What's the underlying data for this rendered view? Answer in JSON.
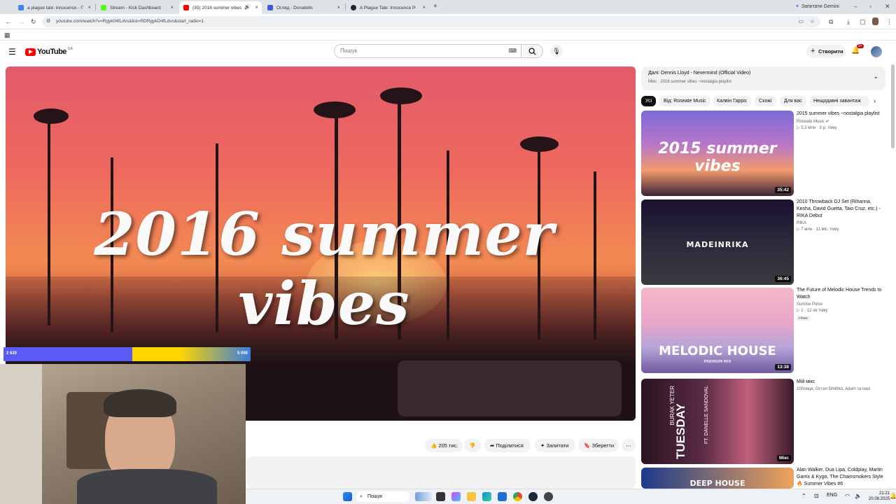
{
  "browser": {
    "tabs": [
      {
        "label": "a plague tale: innocence - Пош",
        "favicon_color": "#4285f4"
      },
      {
        "label": "Stream - Kick Dashboard",
        "favicon_color": "#53fc18"
      },
      {
        "label": "(35) 2016 summer vibes ~n",
        "favicon_color": "#ff0000"
      },
      {
        "label": "Огляд - Donatello",
        "favicon_color": "#3b5bdb"
      },
      {
        "label": "A Plague Tale: Innocence Price",
        "favicon_color": "#1b2838"
      }
    ],
    "gemini_button": "Запитати Gemini",
    "url": "youtube.com/watch?v=Rgyk04fLdvs&list=RDRgykO4fLdvs&start_radio=1"
  },
  "youtube": {
    "logo_text": "YouTube",
    "region": "UA",
    "search_placeholder": "Пошук",
    "create_label": "Створити",
    "notif_count": "9+"
  },
  "video": {
    "title_overlay": "2016 summer vibes"
  },
  "stream_overlay": {
    "goal_left": "2 620",
    "goal_right": "5 000",
    "goal_fraction": 0.52
  },
  "actions": {
    "likes": "205 тис.",
    "share": "Поділитися",
    "ask": "Запитати",
    "save": "Зберегти"
  },
  "sidebar": {
    "next_label": "Далі: Dennis Lloyd - Nevermind (Official Video)",
    "next_sub": "Мікс · 2016 summer vibes ~nostalgia playlist",
    "chips": [
      "Усі",
      "Від: Roseate Music",
      "Калвін Гарріс",
      "Схожі",
      "Для вас",
      "Нещодавні завантаж"
    ],
    "videos": [
      {
        "title": "2015 summer vibes ~nostalgia playlist",
        "channel": "Roseate Music",
        "meta": "▷ 5,3 млн · 3 р. тому",
        "duration": "35:42",
        "thumb_text": "2015 summer vibes",
        "badge": ""
      },
      {
        "title": "2010 Throwback DJ Set (Rihanna, Kesha, David Guetta, Taio Cruz, etc.) - RIKA Debut",
        "channel": "RIKA",
        "meta": "▷ 7 млн · 11 міс. тому",
        "duration": "36:45",
        "thumb_text": "MADEINRIKA",
        "badge": ""
      },
      {
        "title": "The Future of Melodic House  Trends to Watch",
        "channel": "Sunrise Pulse",
        "meta": "▷ 1 · 12 хв тому",
        "duration": "13:38",
        "thumb_text": "MELODIC HOUSE",
        "thumb_sub": "PREMIUM MIX",
        "badge": "Нове"
      },
      {
        "title": "Мій мікс",
        "channel": "100лиця, Остап Dmitrko, Adam та інші",
        "meta": "",
        "duration": "Мікс",
        "thumb_text": "TUESDAY",
        "thumb_sub": "BURAK YETER",
        "thumb_sub2": "FT. DANELLE SANDOVAL",
        "badge": ""
      },
      {
        "title": "Alan Walker, Dua Lipa, Coldplay, Martin Garrix & Kygo, The Chainsmokers Style 🔥 Summer Vibes #6",
        "channel": "",
        "meta": "",
        "duration": "",
        "thumb_text": "DEEP HOUSE",
        "badge": ""
      }
    ]
  },
  "taskbar": {
    "search_label": "Пошук",
    "lang": "ENG",
    "time": "21:21",
    "date": "20.08.2025"
  }
}
